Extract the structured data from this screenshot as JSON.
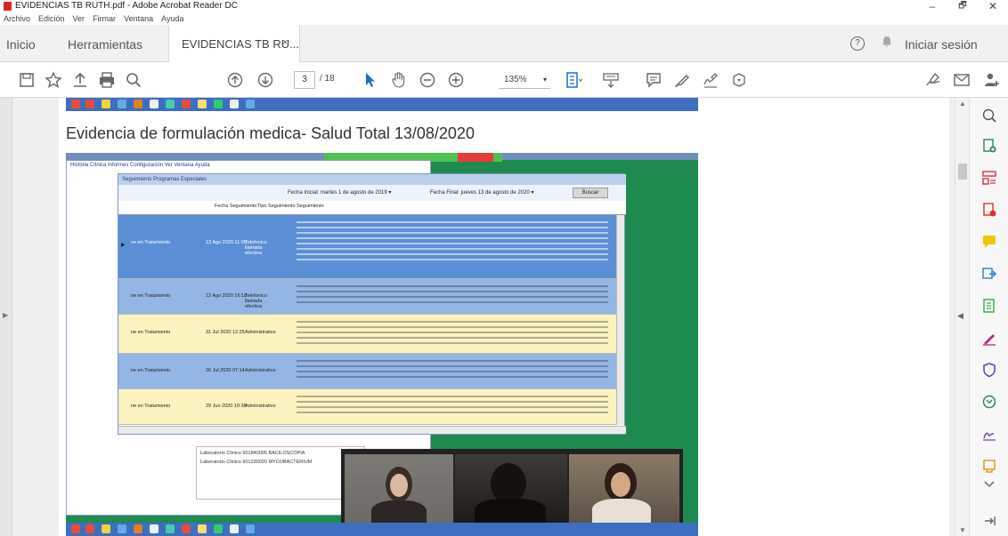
{
  "window": {
    "title": "EVIDENCIAS TB RUTH.pdf - Adobe Acrobat Reader DC",
    "minimize": "–",
    "maximize": "🗗",
    "close": "✕"
  },
  "menu": [
    "Archivo",
    "Edición",
    "Ver",
    "Firmar",
    "Ventana",
    "Ayuda"
  ],
  "tabs": {
    "home": "Inicio",
    "tools": "Herramientas",
    "doc": "EVIDENCIAS TB RU...",
    "doc_close": "×"
  },
  "header": {
    "help_icon": "?",
    "signin": "Iniciar sesión"
  },
  "toolbar": {
    "page_current": "3",
    "page_total": "/ 18",
    "zoom": "135%",
    "zoom_arrow": "▾"
  },
  "document": {
    "heading": "Evidencia de formulación medica- Salud Total 13/08/2020"
  },
  "embedded": {
    "outer_menu": "Historia Clínica   Informes   Configuración   Ver   Ventana   Ayuda",
    "inner_title": "Seguimiento Programas Especiales",
    "fecha_inicial": "Fecha Inicial:   martes   1 de  agosto  de 2019 ▾",
    "fecha_final": "Fecha Final:   jueves  13 de  agosto  de 2020 ▾",
    "buscar": "Buscar",
    "columns": [
      "Fecha Seguimiento",
      "Tipo Seguimiento",
      "Seguimiento"
    ],
    "rows": [
      {
        "estado": "ne en Tratamiento",
        "fecha": "13 Ago 2020 11:05",
        "tipo": "Telefonico llamada efectiva"
      },
      {
        "estado": "ne en Tratamiento",
        "fecha": "12 Ago 2020 16:18",
        "tipo": "Telefonico llamada efectiva"
      },
      {
        "estado": "ne en Tratamiento",
        "fecha": "31 Jul 2020 12:25",
        "tipo": "Administrativo"
      },
      {
        "estado": "ne en Tratamiento",
        "fecha": "30 Jul 2020 07:14",
        "tipo": "Administrativo"
      },
      {
        "estado": "ne en Tratamiento",
        "fecha": "29 Jun 2020 10:38",
        "tipo": "Administrativo"
      }
    ],
    "lab_lines": [
      "Laboratorio Clinico 901840005 BACILOSCOPIA",
      "Laboratorio Clinico 901230020 MYCOBACTERIUM"
    ]
  },
  "colors": {
    "selected_row": "#5a8fd6",
    "row_blue": "#93b6e4",
    "row_yellow": "#fbf3bf",
    "taskbar": "#3c6fbf",
    "desktop_green": "#1f8a50"
  }
}
